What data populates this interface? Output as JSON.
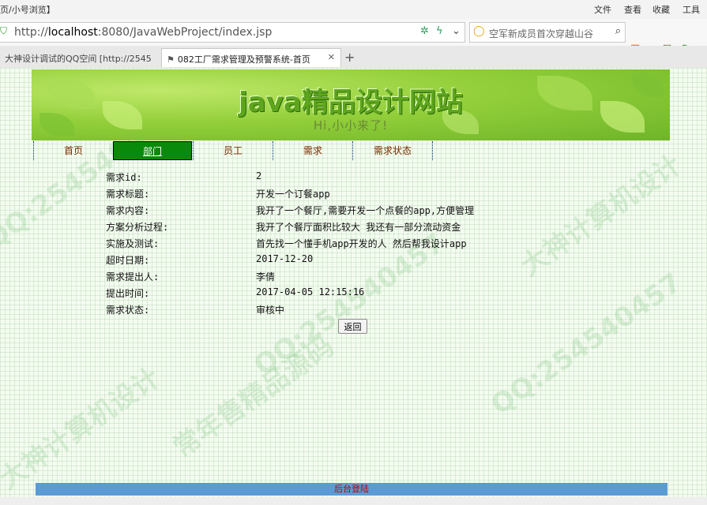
{
  "browser": {
    "window_title": "页/小号浏览】",
    "menu": [
      "文件",
      "查看",
      "收藏",
      "工具"
    ],
    "url_prefix": "http://",
    "url_host": "localhost",
    "url_rest": ":8080/JavaWebProject/index.jsp",
    "search_text": "空军新成员首次穿越山谷",
    "tabs": [
      {
        "label": "大神设计调试的QQ空间 [http://2545",
        "active": false
      },
      {
        "label": "082工厂需求管理及预警系统-首页",
        "active": true
      }
    ]
  },
  "site": {
    "title": "java精品设计网站",
    "greeting": "Hi,小小来了!"
  },
  "nav": [
    {
      "label": "首页",
      "active": false
    },
    {
      "label": "部门",
      "active": true
    },
    {
      "label": "员工",
      "active": false
    },
    {
      "label": "需求",
      "active": false
    },
    {
      "label": "需求状态",
      "active": false
    }
  ],
  "details": [
    {
      "label": "需求id:",
      "value": "2"
    },
    {
      "label": "需求标题:",
      "value": "开发一个订餐app"
    },
    {
      "label": "需求内容:",
      "value": "我开了一个餐厅,需要开发一个点餐的app,方便管理"
    },
    {
      "label": "方案分析过程:",
      "value": "我开了个餐厅面积比较大 我还有一部分流动资金"
    },
    {
      "label": "实施及测试:",
      "value": "首先找一个懂手机app开发的人 然后帮我设计app"
    },
    {
      "label": "超时日期:",
      "value": "2017-12-20"
    },
    {
      "label": "需求提出人:",
      "value": "李倩"
    },
    {
      "label": "提出时间:",
      "value": "2017-04-05 12:15:16"
    },
    {
      "label": "需求状态:",
      "value": "审核中"
    }
  ],
  "back_button": "返回",
  "footer_link": "后台登陆",
  "watermarks": [
    "QQ:254540457",
    "大神计算机设计",
    "常年售精品源码"
  ]
}
